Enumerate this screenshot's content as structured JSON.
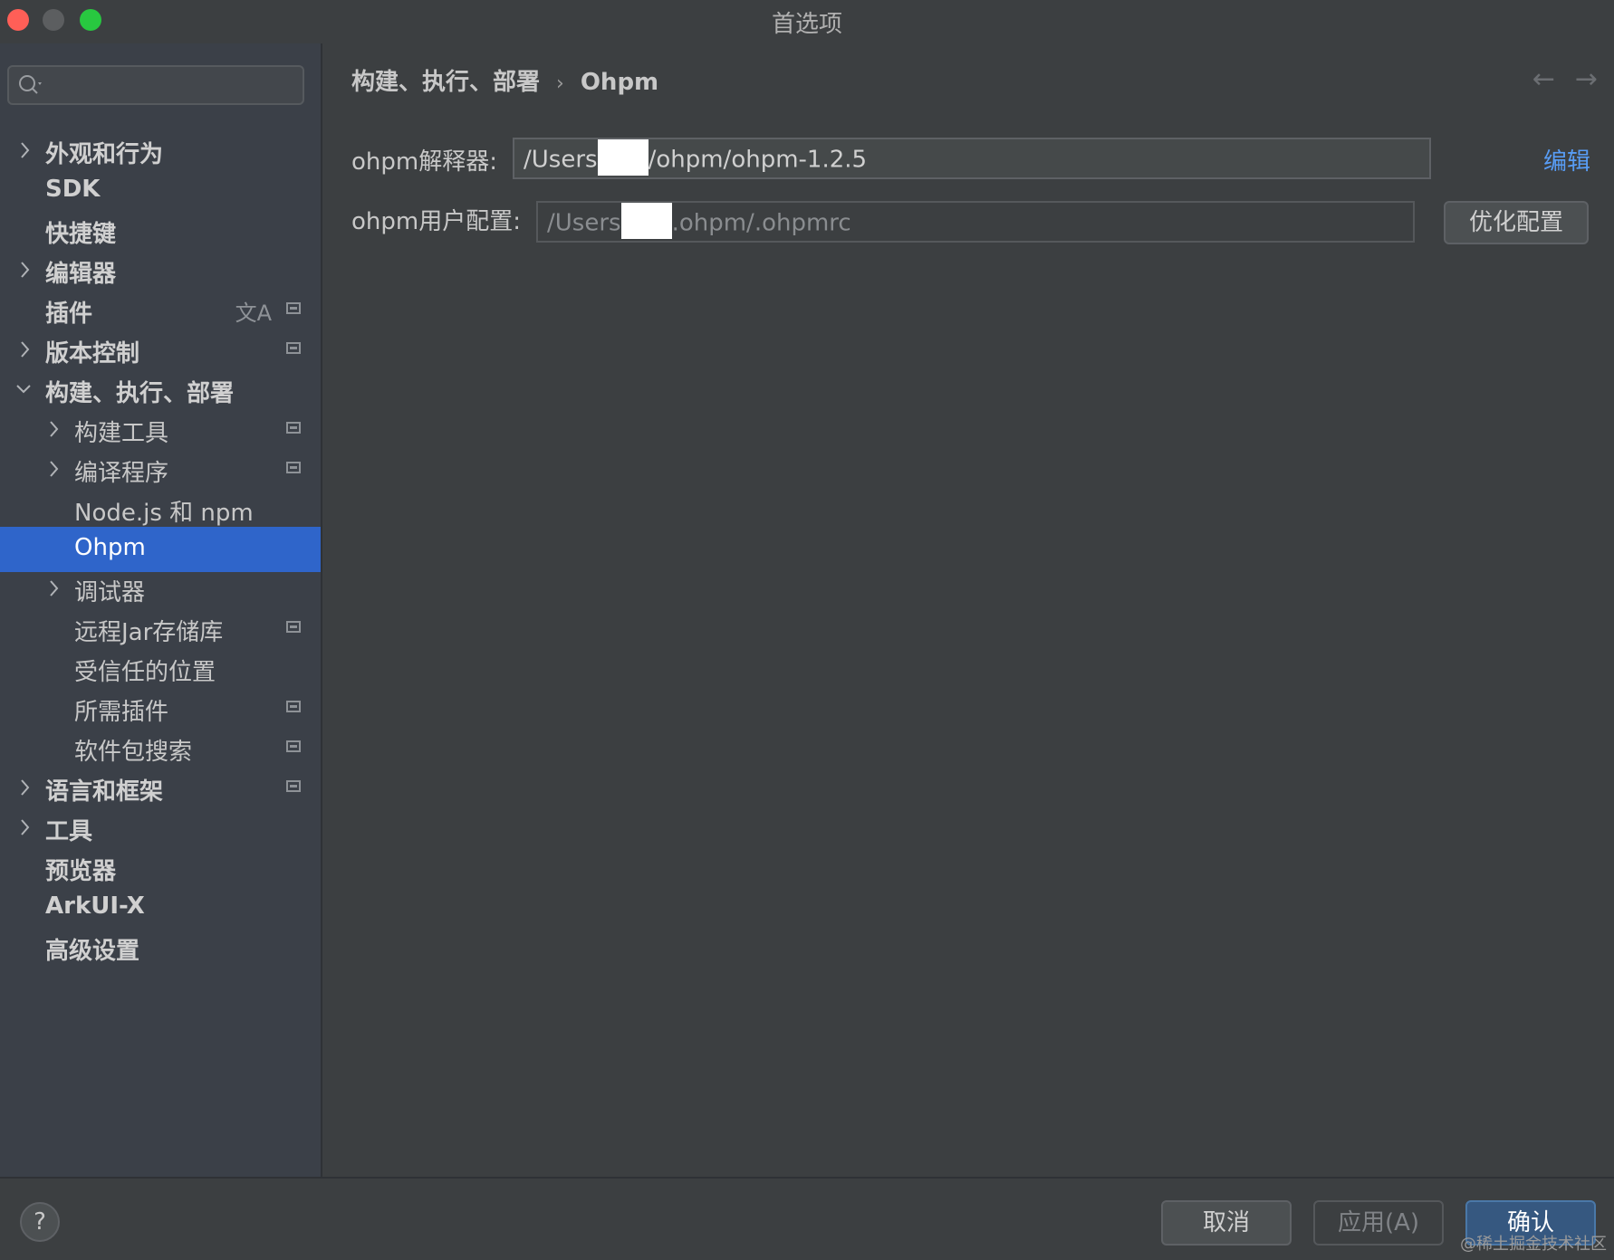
{
  "window": {
    "title": "首选项"
  },
  "sidebar": {
    "search_placeholder": "",
    "items": [
      {
        "label": "外观和行为",
        "chevron": "right",
        "bold": true
      },
      {
        "label": "SDK",
        "bold": true
      },
      {
        "label": "快捷键",
        "bold": true
      },
      {
        "label": "编辑器",
        "chevron": "right",
        "bold": true
      },
      {
        "label": "插件",
        "bold": true,
        "badge": true,
        "translate_icon": "文A"
      },
      {
        "label": "版本控制",
        "chevron": "right",
        "bold": true,
        "badge": true
      },
      {
        "label": "构建、执行、部署",
        "chevron": "down",
        "bold": true
      },
      {
        "label": "构建工具",
        "chevron": "right",
        "child": true,
        "badge": true
      },
      {
        "label": "编译程序",
        "chevron": "right",
        "child": true,
        "badge": true
      },
      {
        "label": "Node.js 和 npm",
        "child": true
      },
      {
        "label": "Ohpm",
        "child": true,
        "selected": true
      },
      {
        "label": "调试器",
        "chevron": "right",
        "child": true
      },
      {
        "label": "远程Jar存储库",
        "child": true,
        "badge": true
      },
      {
        "label": "受信任的位置",
        "child": true
      },
      {
        "label": "所需插件",
        "child": true,
        "badge": true
      },
      {
        "label": "软件包搜索",
        "child": true,
        "badge": true
      },
      {
        "label": "语言和框架",
        "chevron": "right",
        "bold": true,
        "badge": true
      },
      {
        "label": "工具",
        "chevron": "right",
        "bold": true
      },
      {
        "label": "预览器",
        "bold": true
      },
      {
        "label": "ArkUI-X",
        "bold": true
      },
      {
        "label": "高级设置",
        "bold": true
      }
    ]
  },
  "content": {
    "breadcrumb": {
      "parent": "构建、执行、部署",
      "separator": "›",
      "current": "Ohpm"
    },
    "nav": {
      "back": "←",
      "forward": "→"
    },
    "interpreter": {
      "label": "ohpm解释器:",
      "value_prefix": "/Users",
      "value_suffix": "/ohpm/ohpm-1.2.5",
      "edit_link": "编辑"
    },
    "user_config": {
      "label": "ohpm用户配置:",
      "value_prefix": "/Users",
      "value_suffix": ".ohpm/.ohpmrc",
      "optimize_button": "优化配置"
    }
  },
  "footer": {
    "help": "?",
    "cancel": "取消",
    "apply": "应用(A)",
    "ok": "确认",
    "watermark": "@稀土掘金技术社区"
  },
  "colors": {
    "selection": "#2f65ca",
    "link": "#589df6",
    "close": "#ff5f57",
    "maximize": "#28c840"
  }
}
